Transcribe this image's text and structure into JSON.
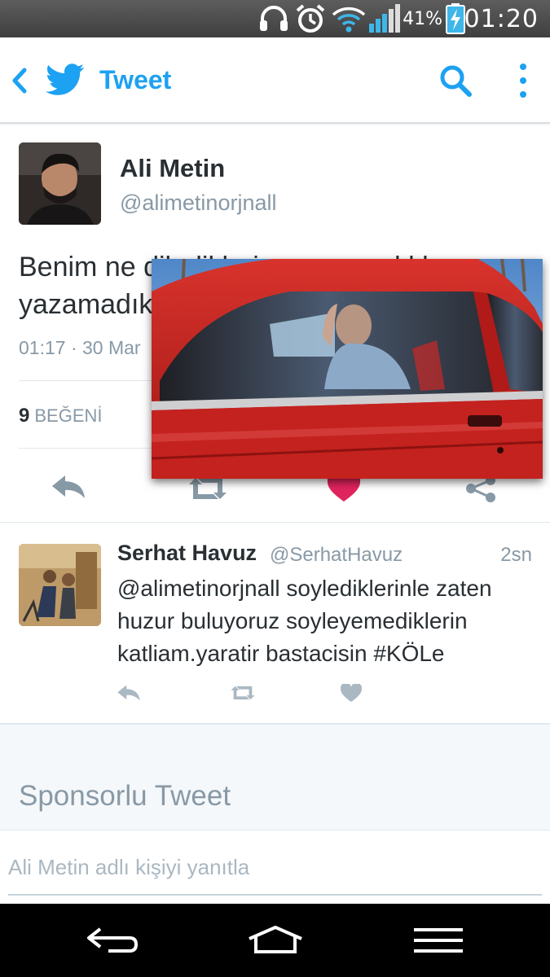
{
  "status_bar": {
    "battery_percent": "41%",
    "time": "01:20",
    "icons": [
      "headset-icon",
      "alarm-icon",
      "wifi-icon",
      "signal-icon",
      "battery-charging-icon"
    ]
  },
  "app_bar": {
    "title": "Tweet",
    "icons": [
      "back-icon",
      "twitter-bird-icon",
      "search-icon",
      "overflow-menu-icon"
    ]
  },
  "tweet": {
    "author_name": "Ali Metin",
    "author_handle": "@alimetinorjnall",
    "text": "Benim ne dilediklerim var, yazdıklarım var yazamadıklarım var",
    "timestamp": "01:17 · 30 Mar",
    "likes_count": "9",
    "likes_label": "BEĞENİ"
  },
  "reply": {
    "author_name": "Serhat Havuz",
    "author_handle": "@SerhatHavuz",
    "time_ago": "2sn",
    "text": "@alimetinorjnall soylediklerinle zaten huzur buluyoruz soyleyemediklerin katliam.yaratir bastacisin #KÖLe"
  },
  "sponsored": {
    "label": "Sponsorlu Tweet"
  },
  "reply_box": {
    "placeholder": "Ali Metin adlı kişiyi yanıtla"
  },
  "nav_bar": {
    "icons": [
      "nav-back-icon",
      "nav-home-icon",
      "nav-menu-icon"
    ]
  },
  "colors": {
    "accent": "#1da1f2",
    "like": "#e0245e",
    "secondary_text": "#8899a6",
    "action_icon": "#8899a6",
    "reply_action_icon": "#aab8c2"
  }
}
